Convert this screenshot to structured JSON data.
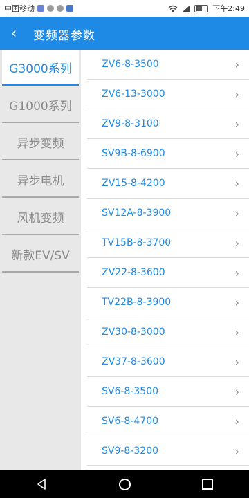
{
  "status_bar": {
    "carrier": "中国移动",
    "time": "下午2:49",
    "battery_level": 0.6,
    "icons": [
      "notification-icon",
      "cloud-icon",
      "message-icon",
      "app-icon",
      "wifi-icon",
      "signal-icon",
      "battery-icon"
    ]
  },
  "app_bar": {
    "back_icon": "‹",
    "title": "变频器参数",
    "color": "#1f8ae6"
  },
  "sidebar": {
    "items": [
      {
        "label": "G3000系列",
        "active": true
      },
      {
        "label": "G1000系列",
        "active": false
      },
      {
        "label": "异步变频",
        "active": false
      },
      {
        "label": "异步电机",
        "active": false
      },
      {
        "label": "风机变频",
        "active": false
      },
      {
        "label": "新款EV/SV",
        "active": false
      }
    ]
  },
  "list": {
    "chevron": "›",
    "items": [
      {
        "label": "ZV6-8-3500"
      },
      {
        "label": "ZV6-13-3000"
      },
      {
        "label": "ZV9-8-3100"
      },
      {
        "label": "SV9B-8-6900"
      },
      {
        "label": "ZV15-8-4200"
      },
      {
        "label": "SV12A-8-3900"
      },
      {
        "label": "TV15B-8-3700"
      },
      {
        "label": "ZV22-8-3600"
      },
      {
        "label": "TV22B-8-3900"
      },
      {
        "label": "ZV30-8-3000"
      },
      {
        "label": "ZV37-8-3600"
      },
      {
        "label": "SV6-8-3500"
      },
      {
        "label": "SV6-8-4700"
      },
      {
        "label": "SV9-8-3200"
      },
      {
        "label": ""
      }
    ]
  },
  "nav_bar": {
    "icons": [
      "back-triangle-icon",
      "home-circle-icon",
      "recent-square-icon"
    ]
  }
}
